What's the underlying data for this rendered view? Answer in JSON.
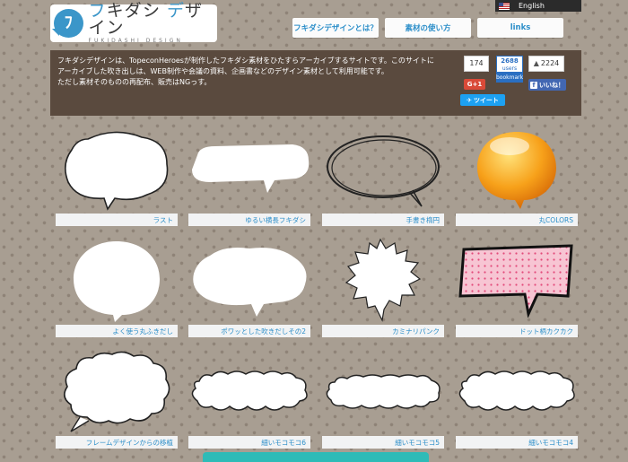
{
  "lang": {
    "label": "English"
  },
  "logo": {
    "main_a": "フ",
    "main_b": "キダシ",
    "main_c": "デ",
    "main_d": "ザイン",
    "sub": "FUKIDASHI DESIGN"
  },
  "nav": [
    {
      "label": "フキダシデザインとは？"
    },
    {
      "label": "素材の使い方"
    },
    {
      "label": "links"
    }
  ],
  "about": {
    "text_1": "フキダシデザインは、TopeconHeroesが制作したフキダシ素材をひたすらアーカイブするサイトです。このサイトに",
    "text_2": "アーカイブした吹き出しは、WEB制作や会議の資料、企画書などのデザイン素材として利用可能です。",
    "text_3": "ただし素材そのものの再配布、販売はNGっす。"
  },
  "social": {
    "count": "174",
    "hatena_count": "2688",
    "hatena_users": "users",
    "hatena_label": "bookmark",
    "like_count": "2224",
    "gplus": "G+1",
    "facebook": "いいね！",
    "tweet": "ツイート"
  },
  "items": [
    {
      "label": "ラスト"
    },
    {
      "label": "ゆるい横長フキダシ"
    },
    {
      "label": "手書き楕円"
    },
    {
      "label": "丸COLORS"
    },
    {
      "label": "よく使う丸ふきだし"
    },
    {
      "label": "ポワッとした吹きだしその2"
    },
    {
      "label": "カミナリパンク"
    },
    {
      "label": "ドット柄カクカク"
    },
    {
      "label": "フレームデザインからの移植"
    },
    {
      "label": "細いモコモコ6"
    },
    {
      "label": "細いモコモコ5"
    },
    {
      "label": "細いモコモコ4"
    }
  ],
  "colors": {
    "accent": "#2b8ec9",
    "header_bg": "#5a4a3e",
    "orange": "#f59a16",
    "pink": "#f6c3d2"
  }
}
